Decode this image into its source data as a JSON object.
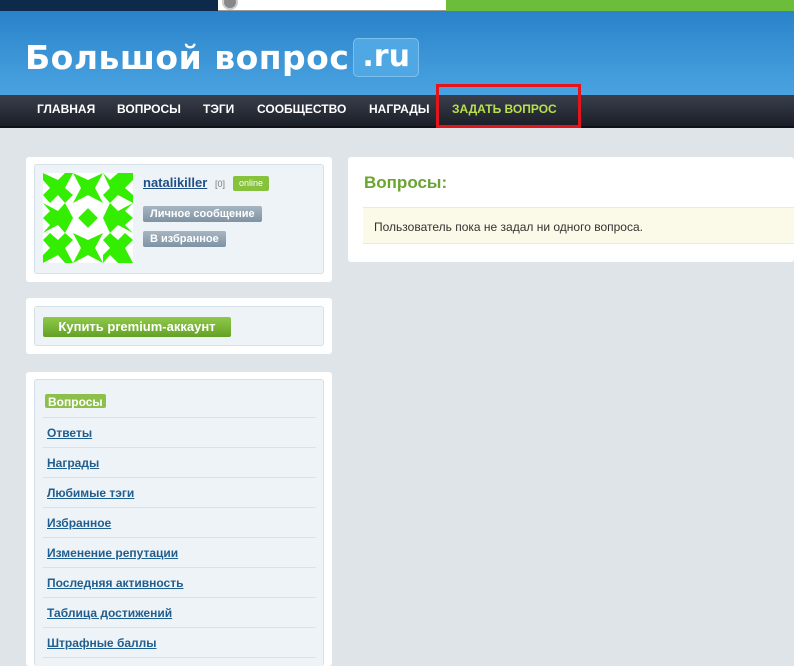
{
  "site": {
    "logo_main": "Большой вопрос",
    "logo_tld": ".ru"
  },
  "nav": {
    "items": [
      {
        "label": "ГЛАВНАЯ"
      },
      {
        "label": "ВОПРОСЫ"
      },
      {
        "label": "ТЭГИ"
      },
      {
        "label": "СООБЩЕСТВО"
      },
      {
        "label": "НАГРАДЫ"
      },
      {
        "label": "ЗАДАТЬ ВОПРОС"
      }
    ],
    "highlight_color": "#e3141b",
    "ask_color": "#b8e04a"
  },
  "profile": {
    "username": "natalikiller",
    "reputation": "[0]",
    "status": "online",
    "message_button": "Личное сообщение",
    "favorite_button": "В избранное"
  },
  "premium": {
    "button_label": "Купить premium-аккаунт"
  },
  "sidebar": {
    "items": [
      {
        "label": "Вопросы",
        "active": true
      },
      {
        "label": "Ответы"
      },
      {
        "label": "Награды"
      },
      {
        "label": "Любимые тэги"
      },
      {
        "label": "Избранное"
      },
      {
        "label": "Изменение репутации"
      },
      {
        "label": "Последняя активность"
      },
      {
        "label": "Таблица достижений"
      },
      {
        "label": "Штрафные баллы"
      }
    ]
  },
  "main": {
    "title": "Вопросы:",
    "empty_message": "Пользователь пока не задал ни одного вопроса."
  },
  "colors": {
    "accent_green": "#6aa52e",
    "header_blue": "#2a83c9",
    "avatar_green": "#33ee00"
  }
}
